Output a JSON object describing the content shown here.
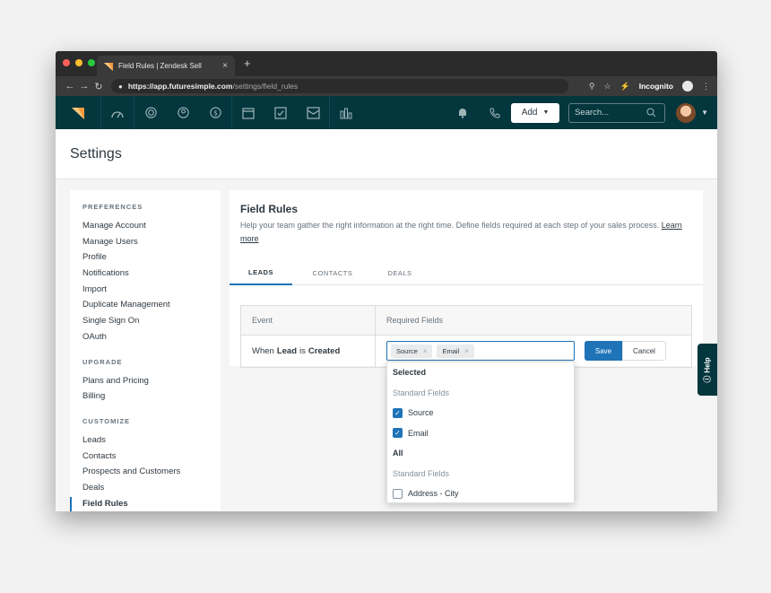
{
  "browser": {
    "tab_title": "Field Rules | Zendesk Sell",
    "tab_close": "×",
    "new_tab": "+",
    "url_host": "https://app.futuresimple.com",
    "url_path": "/settings/field_rules",
    "incognito_label": "Incognito",
    "traffic_lights": [
      "#ff5f56",
      "#ffbd2e",
      "#27c93f"
    ]
  },
  "appnav": {
    "add_label": "Add",
    "search_placeholder": "Search...",
    "icons": [
      "speedometer-icon",
      "target-icon",
      "leads-icon",
      "dollar-icon",
      "calendar-icon",
      "tasks-icon",
      "inbox-icon",
      "reports-icon",
      "bell-icon",
      "phone-icon",
      "search-icon"
    ]
  },
  "settings": {
    "title": "Settings"
  },
  "sidebar": {
    "preferences_label": "PREFERENCES",
    "preferences": [
      "Manage Account",
      "Manage Users",
      "Profile",
      "Notifications",
      "Import",
      "Duplicate Management",
      "Single Sign On",
      "OAuth"
    ],
    "upgrade_label": "UPGRADE",
    "upgrade": [
      "Plans and Pricing",
      "Billing"
    ],
    "customize_label": "CUSTOMIZE",
    "customize": [
      "Leads",
      "Contacts",
      "Prospects and Customers",
      "Deals",
      "Field Rules"
    ],
    "active": "Field Rules"
  },
  "main": {
    "title": "Field Rules",
    "description": "Help your team gather the right information at the right time. Define fields required at each step of your sales process.",
    "learn_more": "Learn more",
    "tabs": [
      "LEADS",
      "CONTACTS",
      "DEALS"
    ],
    "active_tab": "LEADS",
    "table": {
      "col_event": "Event",
      "col_required": "Required Fields",
      "row_event_prefix": "When",
      "row_event_object": "Lead",
      "row_event_mid": "is",
      "row_event_action": "Created"
    },
    "tags": [
      "Source",
      "Email"
    ],
    "tag_remove": "×",
    "save_label": "Save",
    "cancel_label": "Cancel"
  },
  "dropdown": {
    "selected_header": "Selected",
    "selected_group": "Standard Fields",
    "selected_options": [
      "Source",
      "Email"
    ],
    "all_header": "All",
    "all_group": "Standard Fields",
    "all_options": [
      "Address - City"
    ]
  },
  "help": {
    "label": "Help"
  },
  "colors": {
    "nav_bg": "#03363d",
    "accent": "#1f73b7",
    "logo": "#f79a3e"
  }
}
